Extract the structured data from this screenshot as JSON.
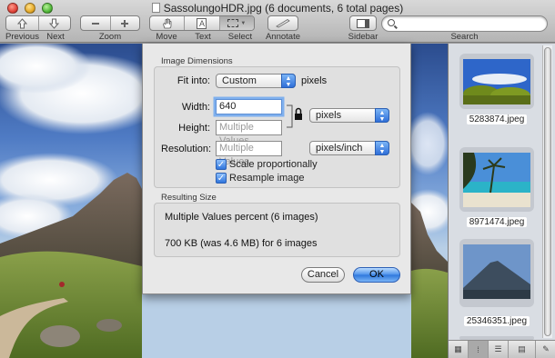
{
  "window": {
    "title": "SassolungoHDR.jpg (6 documents, 6 total pages)"
  },
  "toolbar": {
    "previous_label": "Previous",
    "next_label": "Next",
    "zoom_label": "Zoom",
    "move_label": "Move",
    "text_label": "Text",
    "select_label": "Select",
    "annotate_label": "Annotate",
    "sidebar_label": "Sidebar",
    "search_label": "Search",
    "search_value": ""
  },
  "dialog": {
    "image_dimensions_label": "Image Dimensions",
    "fit_into_label": "Fit into:",
    "fit_into_value": "Custom",
    "fit_into_unit": "pixels",
    "width_label": "Width:",
    "width_value": "640",
    "height_label": "Height:",
    "height_placeholder": "Multiple Values",
    "resolution_label": "Resolution:",
    "resolution_placeholder": "Multiple Values",
    "size_unit_value": "pixels",
    "resolution_unit_value": "pixels/inch",
    "scale_proportionally_label": "Scale proportionally",
    "scale_proportionally_checked": true,
    "resample_label": "Resample image",
    "resample_checked": true,
    "resulting_size_label": "Resulting Size",
    "result_percent_text": "Multiple Values percent (6 images)",
    "result_size_text": "700 KB (was 4.6 MB) for 6 images",
    "cancel_label": "Cancel",
    "ok_label": "OK"
  },
  "sidebar": {
    "thumbnails": [
      {
        "caption": "5283874.jpeg"
      },
      {
        "caption": "8971474.jpeg"
      },
      {
        "caption": "25346351.jpeg"
      }
    ]
  }
}
